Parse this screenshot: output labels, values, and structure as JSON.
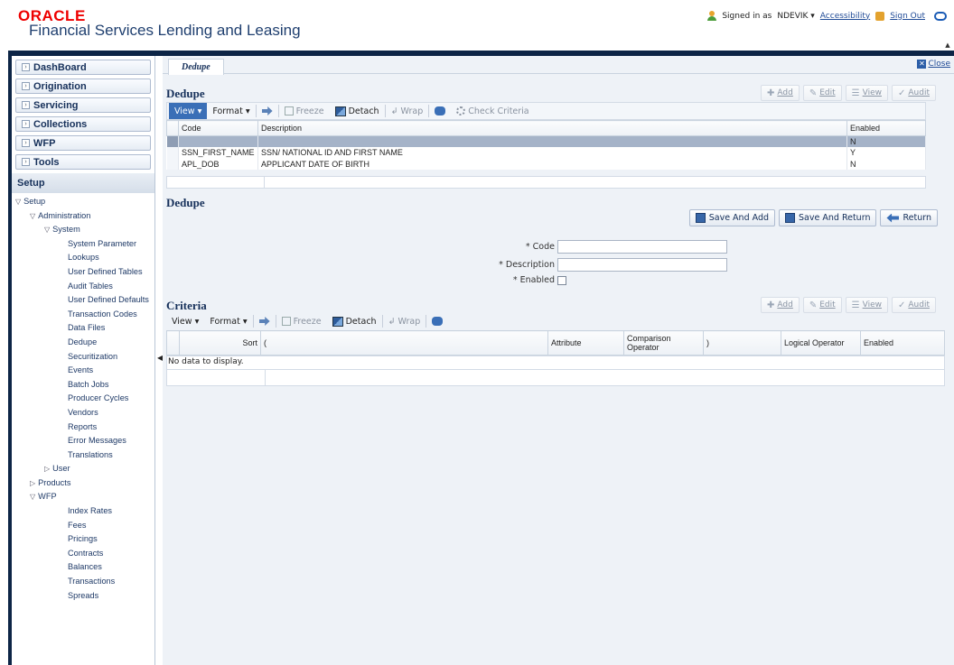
{
  "header": {
    "logo": "ORACLE",
    "app_title": "Financial Services Lending and Leasing",
    "signed_in_label": "Signed in as",
    "user": "NDEVIK ▾",
    "accessibility": "Accessibility",
    "sign_out": "Sign Out"
  },
  "sidebar": {
    "nav": [
      "DashBoard",
      "Origination",
      "Servicing",
      "Collections",
      "WFP",
      "Tools"
    ],
    "setup_header": "Setup",
    "tree": [
      {
        "label": "Setup",
        "level": 0,
        "toggle": "open"
      },
      {
        "label": "Administration",
        "level": 1,
        "toggle": "open"
      },
      {
        "label": "System",
        "level": 2,
        "toggle": "open"
      },
      {
        "label": "System Parameter",
        "level": 3
      },
      {
        "label": "Lookups",
        "level": 3
      },
      {
        "label": "User Defined Tables",
        "level": 3
      },
      {
        "label": "Audit Tables",
        "level": 3
      },
      {
        "label": "User Defined Defaults",
        "level": 3
      },
      {
        "label": "Transaction Codes",
        "level": 3
      },
      {
        "label": "Data Files",
        "level": 3
      },
      {
        "label": "Dedupe",
        "level": 3
      },
      {
        "label": "Securitization",
        "level": 3
      },
      {
        "label": "Events",
        "level": 3
      },
      {
        "label": "Batch Jobs",
        "level": 3
      },
      {
        "label": "Producer Cycles",
        "level": 3
      },
      {
        "label": "Vendors",
        "level": 3
      },
      {
        "label": "Reports",
        "level": 3
      },
      {
        "label": "Error Messages",
        "level": 3
      },
      {
        "label": "Translations",
        "level": 3
      },
      {
        "label": "User",
        "level": 2,
        "toggle": "closed"
      },
      {
        "label": "Products",
        "level": 1,
        "toggle": "closed"
      },
      {
        "label": "WFP",
        "level": 1,
        "toggle": "open"
      },
      {
        "label": "Index Rates",
        "level": 3
      },
      {
        "label": "Fees",
        "level": 3
      },
      {
        "label": "Pricings",
        "level": 3
      },
      {
        "label": "Contracts",
        "level": 3
      },
      {
        "label": "Balances",
        "level": 3
      },
      {
        "label": "Transactions",
        "level": 3
      },
      {
        "label": "Spreads",
        "level": 3
      }
    ]
  },
  "main": {
    "tab": "Dedupe",
    "close": "Close",
    "list_section": {
      "title": "Dedupe",
      "actions": {
        "add": "Add",
        "edit": "Edit",
        "view": "View",
        "audit": "Audit"
      },
      "toolbar": {
        "view": "View ▾",
        "format": "Format ▾",
        "freeze": "Freeze",
        "detach": "Detach",
        "wrap": "Wrap",
        "check_criteria": "Check Criteria"
      },
      "columns": [
        "Code",
        "Description",
        "Enabled"
      ],
      "rows": [
        {
          "code": "",
          "description": "",
          "enabled": "N",
          "selected": true
        },
        {
          "code": "SSN_FIRST_NAME",
          "description": "SSN/ NATIONAL ID AND FIRST NAME",
          "enabled": "Y",
          "selected": false
        },
        {
          "code": "APL_DOB",
          "description": "APPLICANT DATE OF BIRTH",
          "enabled": "N",
          "selected": false
        }
      ]
    },
    "detail_section": {
      "title": "Dedupe",
      "buttons": {
        "save_add": "Save And Add",
        "save_return": "Save And Return",
        "return": "Return"
      },
      "fields": {
        "code_label": "* Code",
        "description_label": "* Description",
        "enabled_label": "* Enabled",
        "code_value": "",
        "description_value": ""
      }
    },
    "criteria_section": {
      "title": "Criteria",
      "actions": {
        "add": "Add",
        "edit": "Edit",
        "view": "View",
        "audit": "Audit"
      },
      "toolbar": {
        "view": "View ▾",
        "format": "Format ▾",
        "freeze": "Freeze",
        "detach": "Detach",
        "wrap": "Wrap"
      },
      "columns": [
        "Sort",
        "(",
        "Attribute",
        "Comparison Operator",
        ")",
        "Logical Operator",
        "Enabled"
      ],
      "no_data": "No data to display."
    }
  }
}
